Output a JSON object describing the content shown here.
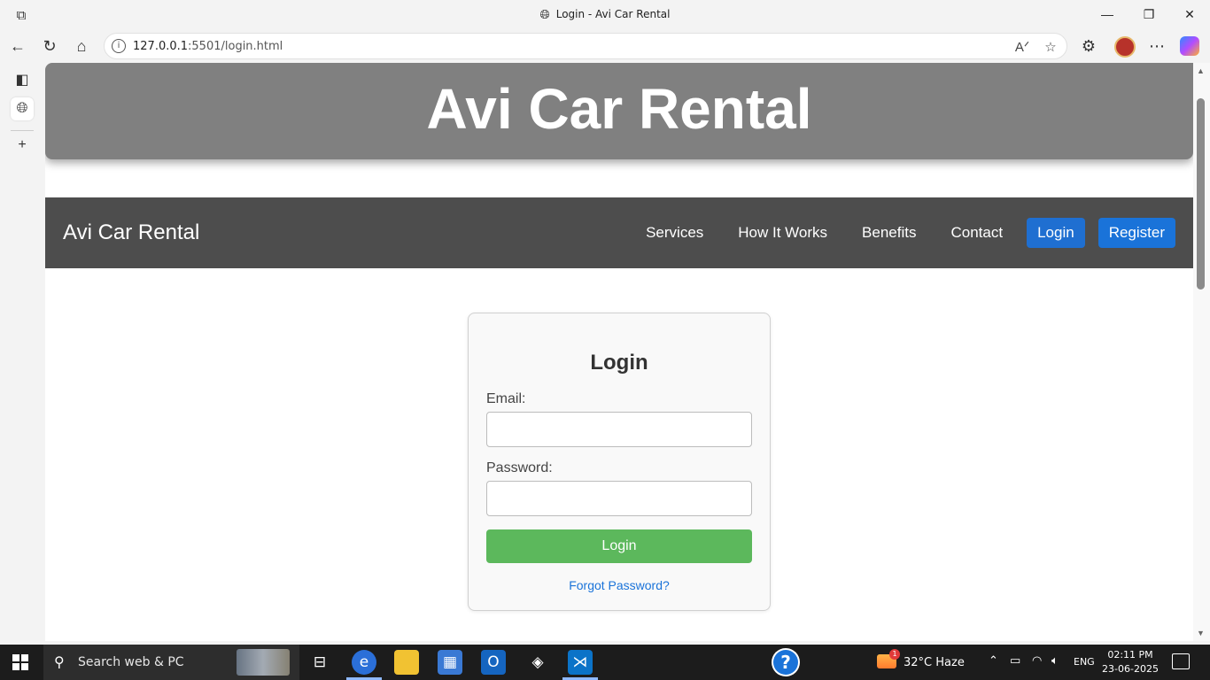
{
  "browser": {
    "tab_title": "Login - Avi Car Rental",
    "url_host": "127.0.0.1",
    "url_rest": ":5501/login.html"
  },
  "page": {
    "hero_title": "Avi Car Rental",
    "brand": "Avi Car Rental",
    "nav": {
      "services": "Services",
      "how_it_works": "How It Works",
      "benefits": "Benefits",
      "contact": "Contact",
      "login": "Login",
      "register": "Register"
    },
    "form": {
      "title": "Login",
      "email_label": "Email:",
      "email_value": "",
      "password_label": "Password:",
      "password_value": "",
      "submit_label": "Login",
      "forgot_label": "Forgot Password?"
    },
    "colors": {
      "hero_bg": "#808080",
      "nav_bg": "#4d4d4d",
      "button_blue": "#1a73d9",
      "submit_green": "#5cb85c"
    }
  },
  "taskbar": {
    "search_placeholder": "Search web & PC",
    "weather_badge": "1",
    "weather": "32°C  Haze",
    "language": "ENG",
    "time": "02:11 PM",
    "date": "23-06-2025"
  }
}
